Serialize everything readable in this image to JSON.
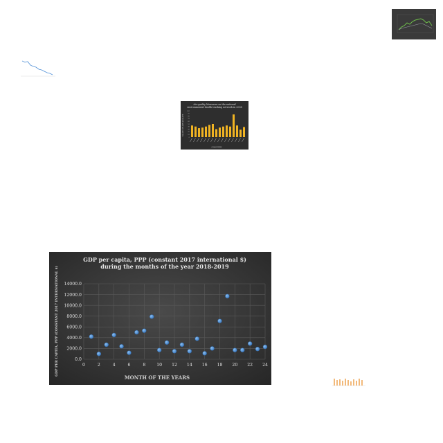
{
  "thumbnails": [
    {
      "id": "thumb-green-line",
      "style": "dark",
      "kind": "line"
    },
    {
      "id": "thumb-blue-line",
      "style": "light",
      "kind": "line"
    },
    {
      "id": "thumb-yellow-bar",
      "style": "dark",
      "kind": "bar",
      "title_lines": [
        "Air quality Measures on the national",
        "environmental health tracking network in 2008"
      ],
      "ylabel": "VALUE OF AIR QUALITY",
      "xlabel": "COUNTRY",
      "values": [
        44,
        40,
        34,
        36,
        40,
        46,
        50,
        30,
        36,
        40,
        44,
        40,
        86,
        44,
        28,
        38
      ],
      "yticks": [
        "100",
        "90",
        "80",
        "70",
        "60",
        "50",
        "40",
        "30",
        "20",
        "10",
        "0"
      ],
      "colors": {
        "bar": "#f0b323",
        "bg": "#2e2e2e"
      }
    },
    {
      "id": "thumb-orange-bar",
      "style": "light",
      "kind": "bar"
    }
  ],
  "chart_data": {
    "type": "scatter",
    "title_lines": [
      "GDP per capita, PPP (constant 2017 international $)",
      "during the months of the year 2018-2019"
    ],
    "xlabel": "MONTH OF THE YEARS",
    "ylabel": "GDP PER CAPITA, PPP (CONSTANT 2017 INTERNATIONAL $)",
    "xlim": [
      0,
      24
    ],
    "ylim": [
      0,
      14000
    ],
    "xticks": [
      "0",
      "2",
      "4",
      "6",
      "8",
      "10",
      "12",
      "14",
      "16",
      "18",
      "20",
      "22",
      "24"
    ],
    "yticks": [
      "0.0",
      "2000.0",
      "4000.0",
      "6000.0",
      "8000.0",
      "10000.0",
      "12000.0",
      "14000.0"
    ],
    "x": [
      1,
      2,
      3,
      4,
      5,
      6,
      7,
      8,
      9,
      10,
      11,
      12,
      13,
      14,
      15,
      16,
      17,
      18,
      19,
      20,
      21,
      22,
      23,
      24
    ],
    "y": [
      4200,
      1000,
      2700,
      4500,
      2400,
      1200,
      5000,
      5300,
      7900,
      1700,
      3100,
      1500,
      2700,
      1500,
      3800,
      1100,
      2000,
      7100,
      11700,
      1700,
      1700,
      2900,
      1900,
      2300
    ],
    "grid": true,
    "colors": {
      "point": "#4f8fd6",
      "background": "#383838",
      "text": "#e0e0e0",
      "grid": "#5a5a5a"
    }
  }
}
